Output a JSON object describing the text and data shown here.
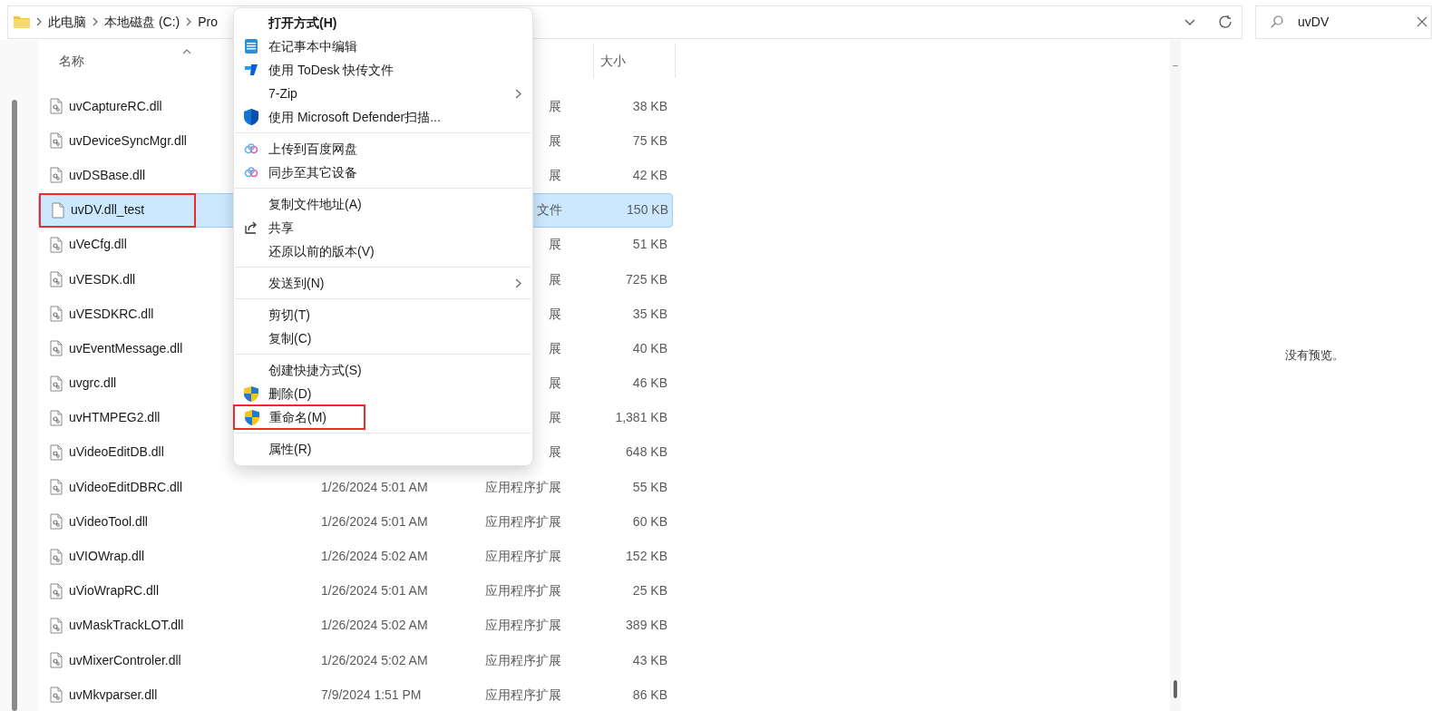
{
  "address_bar": {
    "crumbs": [
      "此电脑",
      "本地磁盘 (C:)",
      "Pro"
    ]
  },
  "search": {
    "value": "uvDV"
  },
  "table": {
    "columns": [
      "名称",
      "大小"
    ],
    "rows": [
      {
        "name": "uvCaptureRC.dll",
        "type": "展",
        "size": "38 KB",
        "selected": false,
        "annotated": false,
        "kind": "dll"
      },
      {
        "name": "uvDeviceSyncMgr.dll",
        "type": "展",
        "size": "75 KB",
        "selected": false,
        "annotated": false,
        "kind": "dll"
      },
      {
        "name": "uvDSBase.dll",
        "type": "展",
        "size": "42 KB",
        "selected": false,
        "annotated": false,
        "kind": "dll"
      },
      {
        "name": "uvDV.dll_test",
        "type": "文件",
        "size": "150 KB",
        "selected": true,
        "annotated": true,
        "kind": "file"
      },
      {
        "name": "uVeCfg.dll",
        "type": "展",
        "size": "51 KB",
        "selected": false,
        "annotated": false,
        "kind": "dll"
      },
      {
        "name": "uVESDK.dll",
        "type": "展",
        "size": "725 KB",
        "selected": false,
        "annotated": false,
        "kind": "dll"
      },
      {
        "name": "uVESDKRC.dll",
        "type": "展",
        "size": "35 KB",
        "selected": false,
        "annotated": false,
        "kind": "dll"
      },
      {
        "name": "uvEventMessage.dll",
        "type": "展",
        "size": "40 KB",
        "selected": false,
        "annotated": false,
        "kind": "dll"
      },
      {
        "name": "uvgrc.dll",
        "type": "展",
        "size": "46 KB",
        "selected": false,
        "annotated": false,
        "kind": "dll"
      },
      {
        "name": "uvHTMPEG2.dll",
        "type": "展",
        "size": "1,381 KB",
        "selected": false,
        "annotated": false,
        "kind": "dll"
      },
      {
        "name": "uVideoEditDB.dll",
        "type": "展",
        "size": "648 KB",
        "selected": false,
        "annotated": false,
        "kind": "dll"
      },
      {
        "name": "uVideoEditDBRC.dll",
        "date": "1/26/2024 5:01 AM",
        "type": "应用程序扩展",
        "size": "55 KB",
        "selected": false,
        "annotated": false,
        "kind": "dll"
      },
      {
        "name": "uVideoTool.dll",
        "date": "1/26/2024 5:01 AM",
        "type": "应用程序扩展",
        "size": "60 KB",
        "selected": false,
        "annotated": false,
        "kind": "dll"
      },
      {
        "name": "uVIOWrap.dll",
        "date": "1/26/2024 5:02 AM",
        "type": "应用程序扩展",
        "size": "152 KB",
        "selected": false,
        "annotated": false,
        "kind": "dll"
      },
      {
        "name": "uVioWrapRC.dll",
        "date": "1/26/2024 5:01 AM",
        "type": "应用程序扩展",
        "size": "25 KB",
        "selected": false,
        "annotated": false,
        "kind": "dll"
      },
      {
        "name": "uvMaskTrackLOT.dll",
        "date": "1/26/2024 5:02 AM",
        "type": "应用程序扩展",
        "size": "389 KB",
        "selected": false,
        "annotated": false,
        "kind": "dll"
      },
      {
        "name": "uvMixerControler.dll",
        "date": "1/26/2024 5:02 AM",
        "type": "应用程序扩展",
        "size": "43 KB",
        "selected": false,
        "annotated": false,
        "kind": "dll"
      },
      {
        "name": "uvMkvparser.dll",
        "date": "7/9/2024 1:51 PM",
        "type": "应用程序扩展",
        "size": "86 KB",
        "selected": false,
        "annotated": false,
        "kind": "dll"
      }
    ]
  },
  "preview": {
    "message": "没有预览。"
  },
  "context_menu": {
    "groups": [
      [
        {
          "label": "打开方式(H)",
          "bold": true,
          "submenu": false,
          "annotated": false
        },
        {
          "label": "在记事本中编辑",
          "kind": "notepad",
          "bold": false,
          "submenu": false,
          "annotated": false
        },
        {
          "label": "使用 ToDesk 快传文件",
          "kind": "todesk",
          "bold": false,
          "submenu": false,
          "annotated": false
        },
        {
          "label": "7-Zip",
          "bold": false,
          "submenu": true,
          "annotated": false
        },
        {
          "label": "使用 Microsoft Defender扫描...",
          "kind": "defender",
          "bold": false,
          "submenu": false,
          "annotated": false
        }
      ],
      [
        {
          "label": "上传到百度网盘",
          "kind": "cloud",
          "bold": false,
          "submenu": false,
          "annotated": false
        },
        {
          "label": "同步至其它设备",
          "kind": "cloud",
          "bold": false,
          "submenu": false,
          "annotated": false
        }
      ],
      [
        {
          "label": "复制文件地址(A)",
          "bold": false,
          "submenu": false,
          "annotated": false
        },
        {
          "label": "共享",
          "kind": "share",
          "bold": false,
          "submenu": false,
          "annotated": false
        },
        {
          "label": "还原以前的版本(V)",
          "bold": false,
          "submenu": false,
          "annotated": false
        }
      ],
      [
        {
          "label": "发送到(N)",
          "bold": false,
          "submenu": true,
          "annotated": false
        }
      ],
      [
        {
          "label": "剪切(T)",
          "bold": false,
          "submenu": false,
          "annotated": false
        },
        {
          "label": "复制(C)",
          "bold": false,
          "submenu": false,
          "annotated": false
        }
      ],
      [
        {
          "label": "创建快捷方式(S)",
          "bold": false,
          "submenu": false,
          "annotated": false
        },
        {
          "label": "删除(D)",
          "kind": "shield",
          "bold": false,
          "submenu": false,
          "annotated": false
        },
        {
          "label": "重命名(M)",
          "kind": "shield",
          "bold": false,
          "submenu": false,
          "annotated": true
        }
      ],
      [
        {
          "label": "属性(R)",
          "bold": false,
          "submenu": false,
          "annotated": false
        }
      ]
    ]
  }
}
